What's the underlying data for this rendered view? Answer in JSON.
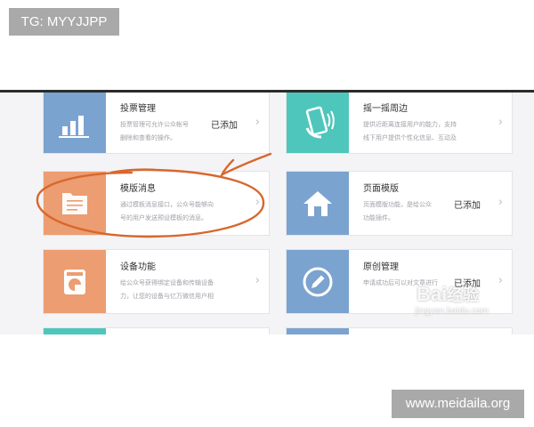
{
  "overlay": {
    "tg_label": "TG: MYYJJPP",
    "site_label": "www.meidaila.org"
  },
  "watermark": {
    "logo_text": "Bai",
    "logo_suffix": "经验",
    "sub_text": "jingyan.baidu.com"
  },
  "cards": [
    {
      "title": "投票管理",
      "desc": "投票管理可允许公众帐号",
      "desc2": "删除和查看的操作。",
      "status": "已添加",
      "icon": "bar-chart-icon",
      "color": "#7ba3cf"
    },
    {
      "title": "摇一摇周边",
      "desc": "提供近距离连接用户的能力，支持",
      "desc2": "线下用户提供个性化信息、互动及",
      "status": "",
      "icon": "shake-phone-icon",
      "color": "#4fc6bb"
    },
    {
      "title": "模版消息",
      "desc": "通过模板消息接口，公众号能够向",
      "desc2": "号的用户发送预设模板的消息。",
      "status": "",
      "icon": "document-icon",
      "color": "#ec9d71"
    },
    {
      "title": "页面模版",
      "desc": "页面模版功能，是给公众",
      "desc2": "功能插件。",
      "status": "已添加",
      "icon": "home-icon",
      "color": "#7ba3cf"
    },
    {
      "title": "设备功能",
      "desc": "给公众号获得绑定设备和传输设备",
      "desc2": "力，让您的设备与亿万微信用户相",
      "status": "",
      "icon": "device-icon",
      "color": "#ec9d71"
    },
    {
      "title": "原创管理",
      "desc": "申请成功后可以对文章进行",
      "desc2": "",
      "status": "已添加",
      "icon": "pencil-circle-icon",
      "color": "#7ba3cf"
    }
  ],
  "chevron": "›"
}
